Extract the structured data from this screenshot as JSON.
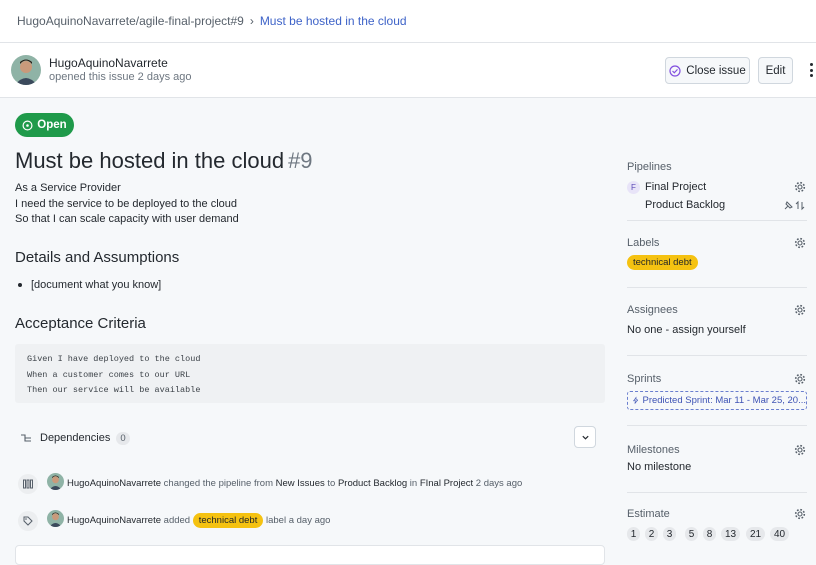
{
  "breadcrumb": {
    "repo": "HugoAquinoNavarrete/agile-final-project#9",
    "separator": "›",
    "current": "Must be hosted in the cloud"
  },
  "header": {
    "author": "HugoAquinoNavarrete",
    "meta": "opened this issue 2 days ago",
    "close_button": "Close issue",
    "edit_button": "Edit"
  },
  "issue": {
    "state": "Open",
    "title": "Must be hosted in the cloud",
    "number": "#9",
    "story": [
      {
        "bold": "As a",
        "rest": " Service Provider"
      },
      {
        "bold": "I need",
        "rest": " the service to be deployed to the cloud"
      },
      {
        "bold": "So that",
        "rest": " I can scale capacity with user demand"
      }
    ],
    "details_heading": "Details and Assumptions",
    "details_item": "[document what you know]",
    "acceptance_heading": "Acceptance Criteria",
    "acceptance_code": "Given I have deployed to the cloud\nWhen a customer comes to our URL\nThen our service will be available",
    "dependencies_label": "Dependencies",
    "dependencies_count": "0"
  },
  "timeline": [
    {
      "user": "HugoAquinoNavarrete",
      "t1": "changed the pipeline from",
      "from": "New Issues",
      "t2": "to",
      "to": "Product Backlog",
      "t3": "in",
      "project": "FInal Project",
      "time": "2 days ago"
    },
    {
      "user": "HugoAquinoNavarrete",
      "t1": "added",
      "label": "technical debt",
      "t2": "label",
      "time": "a day ago"
    }
  ],
  "sidebar": {
    "pipelines_head": "Pipelines",
    "project_badge": "F",
    "project": "Final Project",
    "pipeline": "Product Backlog",
    "labels_head": "Labels",
    "label": "technical debt",
    "assignees_head": "Assignees",
    "assignees_none": "No one -",
    "assign_self": "assign yourself",
    "sprints_head": "Sprints",
    "sprint": "Predicted Sprint: Mar 11 - Mar 25, 20...",
    "milestones_head": "Milestones",
    "milestone": "No milestone",
    "estimate_head": "Estimate",
    "estimates": [
      "1",
      "2",
      "3",
      "5",
      "8",
      "13",
      "21",
      "40"
    ]
  },
  "colors": {
    "open_green": "#1f9a4a",
    "label_yellow": "#f5c211",
    "link_blue": "#3e63c8"
  }
}
